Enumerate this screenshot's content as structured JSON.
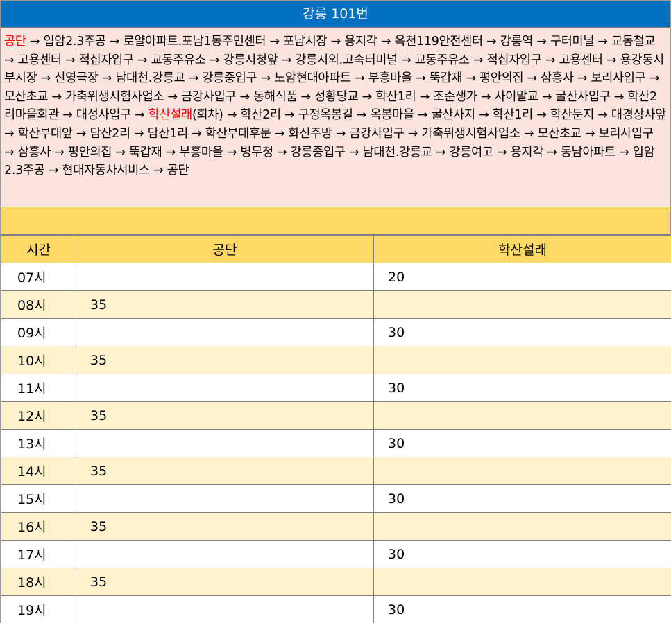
{
  "title": "강릉 101번",
  "route": [
    {
      "text": "공단",
      "hl": true
    },
    {
      "text": " → 입암2.3주공 → 로얄아파트.포남1동주민센터 → 포남시장 → 용지각 → 옥천119안전센터 → 강릉역 → 구터미널 → 교동철교 → 고용센터 → 적십자입구 → 교동주유소 → 강릉시청앞 → 강릉시외.고속터미널 → 교동주유소 → 적십자입구 → 고용센터 → 용강동서부시장 → 신영극장 → 남대천.강릉교 → 강릉중입구 → 노암현대아파트 → 부흥마을 → 뚝갑재 → 평안의집 → 삼흥사 → 보리사입구 → 모산초교 → 가축위생시험사업소 → 금강사입구 → 동해식품 → 성황당교 → 학산1리 → 조순생가 → 사이말교 → 굴산사입구 → 학산2리마을회관 → 대성사입구 → ",
      "hl": false
    },
    {
      "text": "학산설래",
      "hl": true
    },
    {
      "text": "(회차) → 학산2리 → 구정옥봉길 → 옥봉마을 → 굴산사지 → 학산1리 → 학산둔지 → 대경상사앞 → 학산부대앞 → 담산2리 → 담산1리 → 학산부대후문 → 화신주방 → 금강사입구 → 가축위생시험사업소 → 모산초교 → 보리사입구 → 삼흥사 → 평안의집 → 뚝갑재 → 부흥마을 → 병무청 → 강릉중입구 → 남대천.강릉교 → 강릉여고 → 용지각 → 동남아파트 → 입암2.3주공 → 현대자동차서비스 → 공단",
      "hl": false
    }
  ],
  "colors": {
    "title_bg": "#0070c0",
    "route_bg": "#fbe4dd",
    "header_bg": "#ffd966",
    "alt_row_bg": "#fff2cc",
    "highlight": "#ff0000"
  },
  "table": {
    "headers": [
      "시간",
      "공단",
      "학산설래"
    ],
    "rows": [
      [
        "07시",
        "",
        "20"
      ],
      [
        "08시",
        "35",
        ""
      ],
      [
        "09시",
        "",
        "30"
      ],
      [
        "10시",
        "35",
        ""
      ],
      [
        "11시",
        "",
        "30"
      ],
      [
        "12시",
        "35",
        ""
      ],
      [
        "13시",
        "",
        "30"
      ],
      [
        "14시",
        "35",
        ""
      ],
      [
        "15시",
        "",
        "30"
      ],
      [
        "16시",
        "35",
        ""
      ],
      [
        "17시",
        "",
        "30"
      ],
      [
        "18시",
        "35",
        ""
      ],
      [
        "19시",
        "",
        "30"
      ]
    ]
  }
}
